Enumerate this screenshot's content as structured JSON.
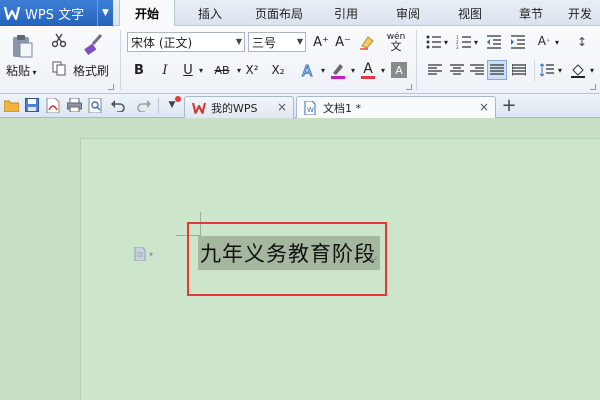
{
  "app": {
    "title": "WPS 文字",
    "drop_arrow": "▼"
  },
  "menu": {
    "tabs": [
      "开始",
      "插入",
      "页面布局",
      "引用",
      "审阅",
      "视图",
      "章节",
      "开发"
    ],
    "active_index": 0
  },
  "ribbon": {
    "paste_label": "粘贴",
    "format_painter_label": "格式刷",
    "font_name": "宋体 (正文)",
    "font_size": "三号",
    "bold": "B",
    "italic": "I",
    "underline": "U",
    "strike": "AB",
    "superscript": "X²",
    "subscript": "X₂",
    "grow_font": "A⁺",
    "shrink_font": "A⁻",
    "phonetic": "wén",
    "font_color": "A",
    "accent_color": "#e53935"
  },
  "doc_tabs": [
    {
      "label": "我的WPS",
      "close": "×"
    },
    {
      "label": "文档1 *",
      "close": "×"
    }
  ],
  "new_tab": "+",
  "document": {
    "heading": "九年义务教育阶段",
    "para_mark": "↵"
  },
  "icons": {
    "app_logo": "wps-logo-icon",
    "paste": "clipboard-icon",
    "cut": "scissors-icon",
    "copy": "copy-icon",
    "format_painter": "brush-icon",
    "open": "folder-icon",
    "save": "save-icon",
    "pdf": "pdf-icon",
    "print": "print-icon",
    "preview": "preview-icon",
    "undo": "undo-icon",
    "redo": "redo-icon"
  }
}
